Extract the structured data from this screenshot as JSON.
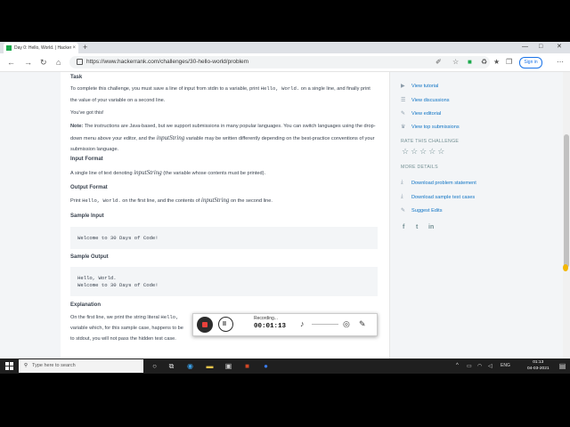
{
  "browser": {
    "tab_title": "Day 0: Hello, World. | HackerRank",
    "tab_close": "×",
    "new_tab": "+",
    "url": "https://www.hackerrank.com/challenges/30-hello-world/problem",
    "signin_label": "Sign in",
    "window_controls": [
      "—",
      "□",
      "✕"
    ]
  },
  "problem": {
    "task_heading": "Task",
    "task_p1_a": "To complete this challenge, you must save a line of input from stdin to a variable, print ",
    "task_p1_code": "Hello, World.",
    "task_p1_b": " on a single line, and finally print the value of your variable on a second line.",
    "task_p2": "You've got this!",
    "note_label": "Note:",
    "note_a": " The instructions are Java-based, but we support submissions in many popular languages. You can switch languages using the drop-down menu above your editor, and the ",
    "note_math": "inputString",
    "note_b": " variable may be written differently depending on the best-practice conventions of your submission language.",
    "input_heading": "Input Format",
    "input_a": "A single line of text denoting ",
    "input_math": "inputString",
    "input_b": " (the variable whose contents must be printed).",
    "output_heading": "Output Format",
    "output_a": "Print ",
    "output_code": "Hello, World.",
    "output_b": " on the first line, and the contents of ",
    "output_math": "inputString",
    "output_c": " on the second line.",
    "sample_input_heading": "Sample Input",
    "sample_input_line": "Welcome to 30 Days of Code!",
    "sample_output_heading": "Sample Output",
    "sample_output_line1": "Hello, World.",
    "sample_output_line2": "Welcome to 30 Days of Code!",
    "explanation_heading": "Explanation",
    "expl_line1_a": "On the first line, we print the string literal ",
    "expl_line1_code": "Hello,",
    "expl_line2": "variable which, for this sample case, happens to be",
    "expl_line3": "to stdout, you will not pass the hidden test case."
  },
  "sidebar": {
    "links_top": [
      {
        "icon": "▶",
        "label": "View tutorial"
      },
      {
        "icon": "☰",
        "label": "View discussions"
      },
      {
        "icon": "✎",
        "label": "View editorial"
      },
      {
        "icon": "♛",
        "label": "View top submissions"
      }
    ],
    "rate_heading": "RATE THIS CHALLENGE",
    "stars": "☆☆☆☆☆",
    "more_heading": "MORE DETAILS",
    "links_more": [
      {
        "icon": "⤓",
        "label": "Download problem statement"
      },
      {
        "icon": "⤓",
        "label": "Download sample test cases"
      },
      {
        "icon": "✎",
        "label": "Suggest Edits"
      }
    ],
    "social": [
      "f",
      "t",
      "in"
    ]
  },
  "recorder": {
    "status": "Recording...",
    "time": "00:01:13",
    "pause_glyph": "II"
  },
  "taskbar": {
    "search_placeholder": "Type here to search",
    "language": "ENG",
    "time": "01:13",
    "date": "04-03-2021"
  }
}
